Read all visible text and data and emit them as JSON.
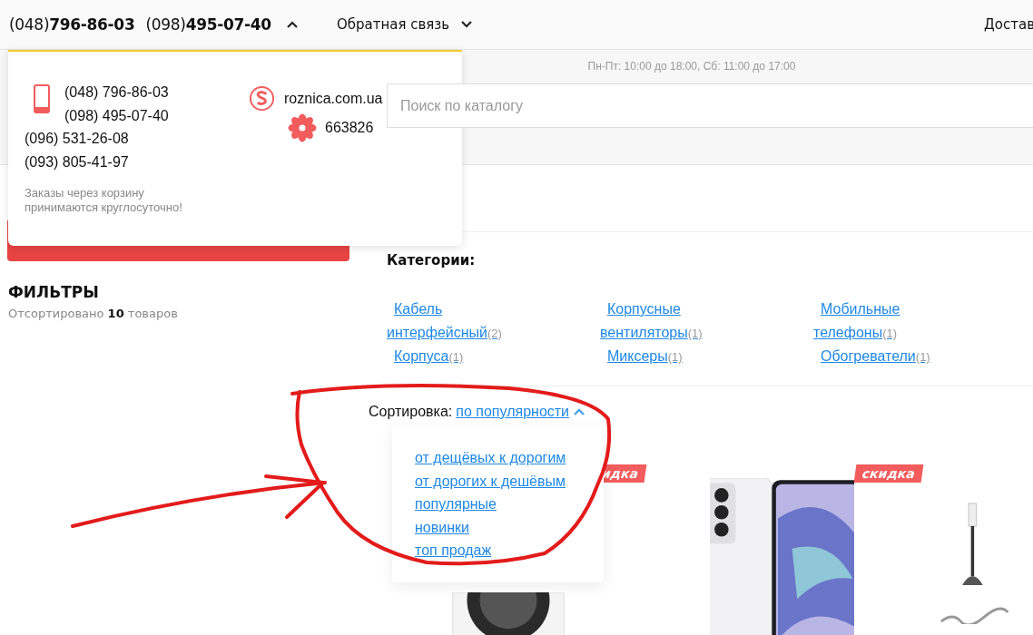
{
  "top_bar": {
    "phones": [
      "(048)**796-86-03**",
      "(098)**495-07-40**"
    ],
    "phones_expanded": true,
    "feedback": "Обратная связь",
    "delivery": "Достав"
  },
  "hours": "Пн-Пт: 10:00 до 18:00, Сб: 11:00 до 17:00",
  "search": {
    "placeholder": "Поиск по каталогу"
  },
  "contacts": {
    "mobile": [
      "(048) 796-86-03",
      "(098) 495-07-40"
    ],
    "landline": [
      "(096) 531-26-08",
      "(093) 805-41-97"
    ],
    "note": "Заказы через корзину принимаются круглосуточно!",
    "skype": "roznica.com.ua",
    "icq": "663826"
  },
  "filters": {
    "title": "ФИЛЬТРЫ",
    "sorted": "Отсортировано **10** товаров"
  },
  "categories": {
    "title": "Категории:",
    "items": [
      {
        "name": "Кабель интерфейсный",
        "count": "(2)"
      },
      {
        "name": "Корпусные вентиляторы",
        "count": "(1)"
      },
      {
        "name": "Мобильные телефоны",
        "count": "(1)"
      },
      {
        "name": "Корпуса",
        "count": "(1)"
      },
      {
        "name": "Миксеры",
        "count": "(1)"
      },
      {
        "name": "Обогреватели",
        "count": "(1)"
      }
    ]
  },
  "sort": {
    "label": "Сортировка:",
    "current": "по популярности",
    "expanded": true,
    "options": [
      "от дещёвых к дорогим",
      "от дорогих к дешёвым",
      "популярные",
      "новинки",
      "топ продаж"
    ]
  },
  "products": [
    {
      "kind": "picture",
      "badge": "идка"
    },
    {
      "kind": "picture",
      "badge": "скидка"
    },
    {
      "kind": "picture"
    }
  ]
}
